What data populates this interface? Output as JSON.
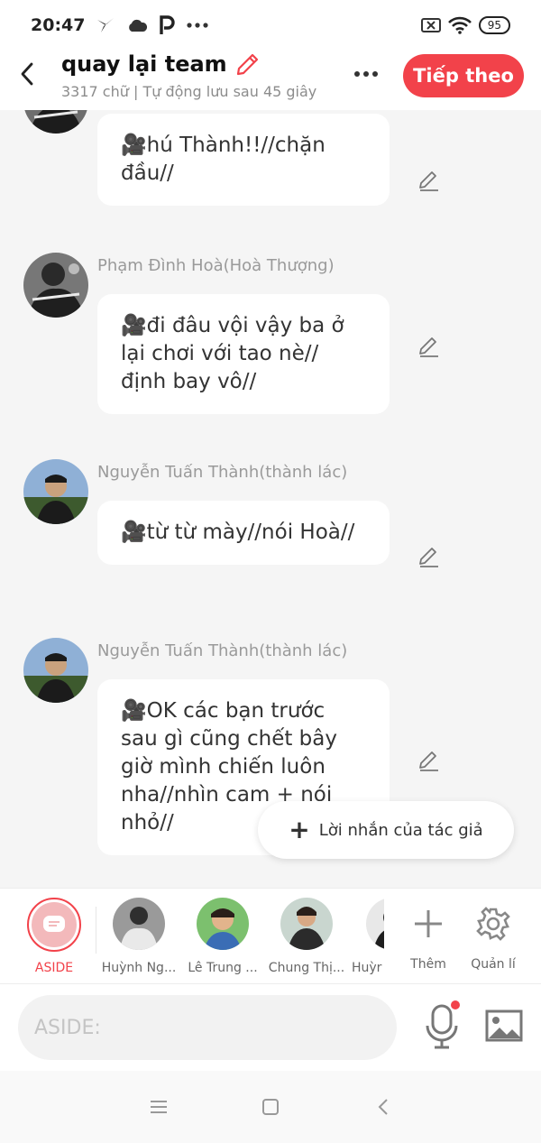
{
  "status": {
    "time": "20:47",
    "battery": "95"
  },
  "header": {
    "title": "quay lại team",
    "subtitle": "3317 chữ | Tự động lưu sau 45 giây",
    "next_label": "Tiếp theo"
  },
  "messages": [
    {
      "sender": "",
      "text": "🎥hú Thành!!//chặn đầu//"
    },
    {
      "sender": "Phạm Đình Hoà(Hoà Thượng)",
      "text": "🎥đi đâu vội vậy ba ở lại chơi với tao nè// định bay vô//"
    },
    {
      "sender": "Nguyễn Tuấn Thành(thành lác)",
      "text": "🎥từ từ mày//nói Hoà//"
    },
    {
      "sender": "Nguyễn Tuấn Thành(thành lác)",
      "text": "🎥OK các bạn trước sau gì cũng chết bây giờ mình chiến luôn nha//nhìn cam + nói nhỏ//"
    }
  ],
  "author_note": {
    "label": "Lời nhắn của tác giả"
  },
  "characters": {
    "aside_label": "ASIDE",
    "items": [
      {
        "name": "Huỳnh Ng..."
      },
      {
        "name": "Lê Trung ..."
      },
      {
        "name": "Chung Thị..."
      },
      {
        "name": "Huỳr"
      }
    ],
    "add_label": "Thêm",
    "manage_label": "Quản lí"
  },
  "input": {
    "placeholder": "ASIDE:"
  },
  "colors": {
    "accent": "#f2424a",
    "bg": "#f5f5f5"
  }
}
